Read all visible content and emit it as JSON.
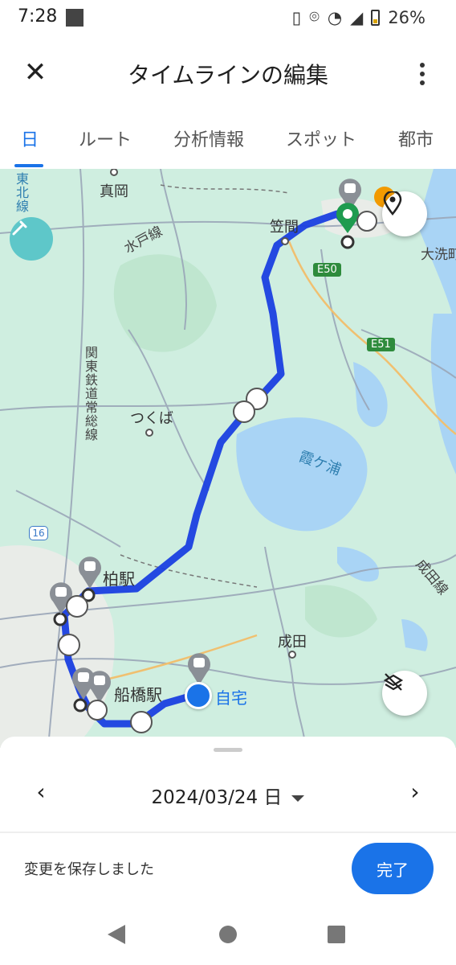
{
  "status": {
    "time": "7:28",
    "battery": "26%"
  },
  "header": {
    "title": "タイムラインの編集"
  },
  "tabs": [
    "日",
    "ルート",
    "分析情報",
    "スポット",
    "都市"
  ],
  "map": {
    "labels": {
      "tohoku": "東北線",
      "mooka": "真岡",
      "mito_line": "水戸線",
      "kasama": "笠間",
      "oarai": "大洗町",
      "e50": "E50",
      "e51": "E51",
      "kanto_rail": "関東鉄道常総線",
      "tsukuba": "つくば",
      "kasumigaura": "霞ケ浦",
      "route16": "16",
      "kashiwa": "柏駅",
      "narita_line": "成田線",
      "narita": "成田",
      "funabashi": "船橋駅",
      "home": "自宅"
    }
  },
  "sheet": {
    "date": "2024/03/24 日",
    "saved_text": "変更を保存しました",
    "done_label": "完了"
  },
  "colors": {
    "accent": "#1a73e8",
    "route": "#1a3fe0",
    "map_land": "#cfeee0"
  }
}
